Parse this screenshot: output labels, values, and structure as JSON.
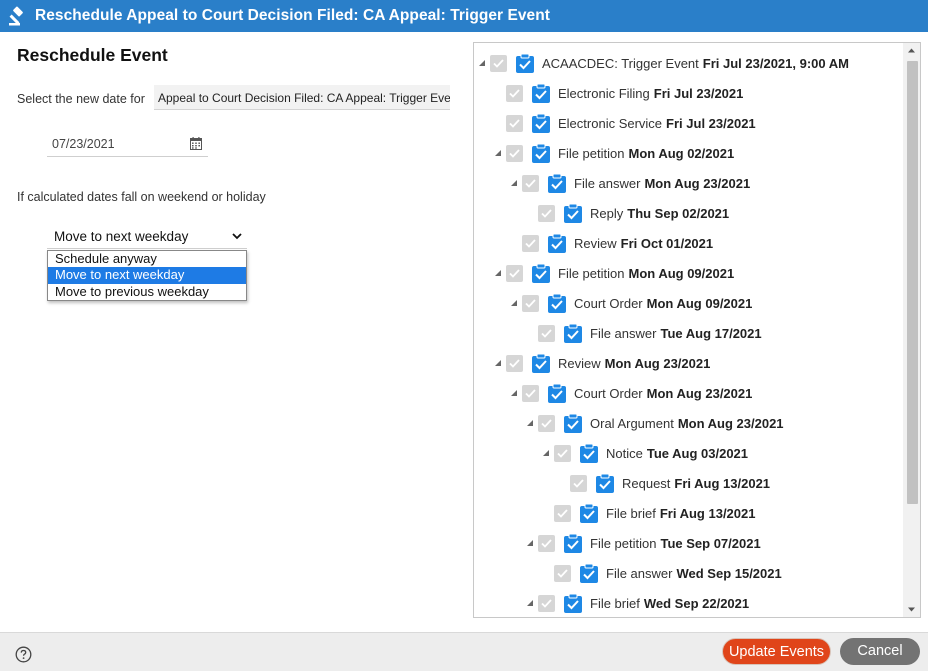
{
  "window": {
    "title": "Reschedule Appeal to Court Decision Filed: CA Appeal: Trigger Event"
  },
  "form": {
    "heading": "Reschedule Event",
    "select_date_label": "Select the new date for",
    "event_name": "Appeal to Court Decision Filed: CA Appeal: Trigger Event",
    "date_value": "07/23/2021",
    "weekend_label": "If calculated dates fall on weekend or holiday",
    "weekend_selected": "Move to next weekday",
    "weekend_options": [
      "Schedule anyway",
      "Move to next weekday",
      "Move to previous weekday"
    ]
  },
  "tree": {
    "rows": [
      {
        "name": "ACAACDEC: Trigger Event",
        "date": "Fri Jul 23/2021, 9:00 AM",
        "expanded": true
      },
      {
        "name": "Electronic Filing",
        "date": "Fri Jul 23/2021"
      },
      {
        "name": "Electronic Service",
        "date": "Fri Jul 23/2021"
      },
      {
        "name": "File petition",
        "date": "Mon Aug 02/2021",
        "expanded": true
      },
      {
        "name": "File answer",
        "date": "Mon Aug 23/2021",
        "expanded": true
      },
      {
        "name": "Reply",
        "date": "Thu Sep 02/2021"
      },
      {
        "name": "Review",
        "date": "Fri Oct 01/2021"
      },
      {
        "name": "File petition",
        "date": "Mon Aug 09/2021",
        "expanded": true
      },
      {
        "name": "Court Order",
        "date": "Mon Aug 09/2021",
        "expanded": true
      },
      {
        "name": "File answer",
        "date": "Tue Aug 17/2021"
      },
      {
        "name": "Review",
        "date": "Mon Aug 23/2021",
        "expanded": true
      },
      {
        "name": "Court Order",
        "date": "Mon Aug 23/2021",
        "expanded": true
      },
      {
        "name": "Oral Argument",
        "date": "Mon Aug 23/2021",
        "expanded": true
      },
      {
        "name": "Notice",
        "date": "Tue Aug 03/2021",
        "expanded": true
      },
      {
        "name": "Request",
        "date": "Fri Aug 13/2021"
      },
      {
        "name": "File brief",
        "date": "Fri Aug 13/2021"
      },
      {
        "name": "File petition",
        "date": "Tue Sep 07/2021",
        "expanded": true
      },
      {
        "name": "File answer",
        "date": "Wed Sep 15/2021"
      },
      {
        "name": "File brief",
        "date": "Wed Sep 22/2021",
        "expanded": true
      }
    ]
  },
  "footer": {
    "update_label": "Update Events",
    "cancel_label": "Cancel"
  },
  "colors": {
    "titlebar": "#2a7fc9",
    "checkbox_blue": "#1e88e5",
    "update_button": "#e0451a",
    "cancel_button": "#737373"
  }
}
